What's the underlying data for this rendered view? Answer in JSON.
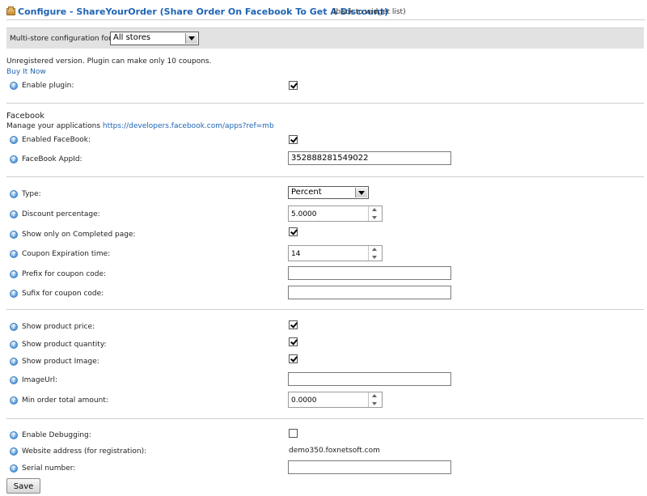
{
  "header": {
    "title": "Configure - ShareYourOrder (Share Order On Facebook To Get A Discount)",
    "back_link": "(back to widget list)"
  },
  "store_bar": {
    "label": "Multi-store configuration for",
    "selected": "All stores"
  },
  "notice": {
    "text": "Unregistered version. Plugin can make only 10 coupons.",
    "buy_link": "Buy It Now"
  },
  "general": {
    "enable_plugin": {
      "label": "Enable plugin:",
      "checked": true
    }
  },
  "facebook": {
    "heading": "Facebook",
    "manage_text": "Manage your applications",
    "manage_link": "https://developers.facebook.com/apps?ref=mb",
    "enabled": {
      "label": "Enabled FaceBook:",
      "checked": true
    },
    "app_id": {
      "label": "FaceBook AppId:",
      "value": "352888281549022"
    }
  },
  "discount": {
    "type": {
      "label": "Type:",
      "value": "Percent"
    },
    "percentage": {
      "label": "Discount percentage:",
      "value": "5.0000"
    },
    "completed_only": {
      "label": "Show only on Completed page:",
      "checked": true
    },
    "expiration": {
      "label": "Coupon Expiration time:",
      "value": "14"
    },
    "prefix": {
      "label": "Prefix for coupon code:",
      "value": ""
    },
    "sufix": {
      "label": "Sufix for coupon code:",
      "value": ""
    }
  },
  "product": {
    "price": {
      "label": "Show product price:",
      "checked": true
    },
    "quantity": {
      "label": "Show product quantity:",
      "checked": true
    },
    "image": {
      "label": "Show product Image:",
      "checked": true
    },
    "image_url": {
      "label": "ImageUrl:",
      "value": ""
    },
    "min_total": {
      "label": "Min order total amount:",
      "value": "0.0000"
    }
  },
  "registration": {
    "debugging": {
      "label": "Enable Debugging:",
      "checked": false
    },
    "website": {
      "label": "Website address (for registration):",
      "value": "demo350.foxnetsoft.com"
    },
    "serial": {
      "label": "Serial number:",
      "value": ""
    }
  },
  "actions": {
    "save_label": "Save"
  }
}
